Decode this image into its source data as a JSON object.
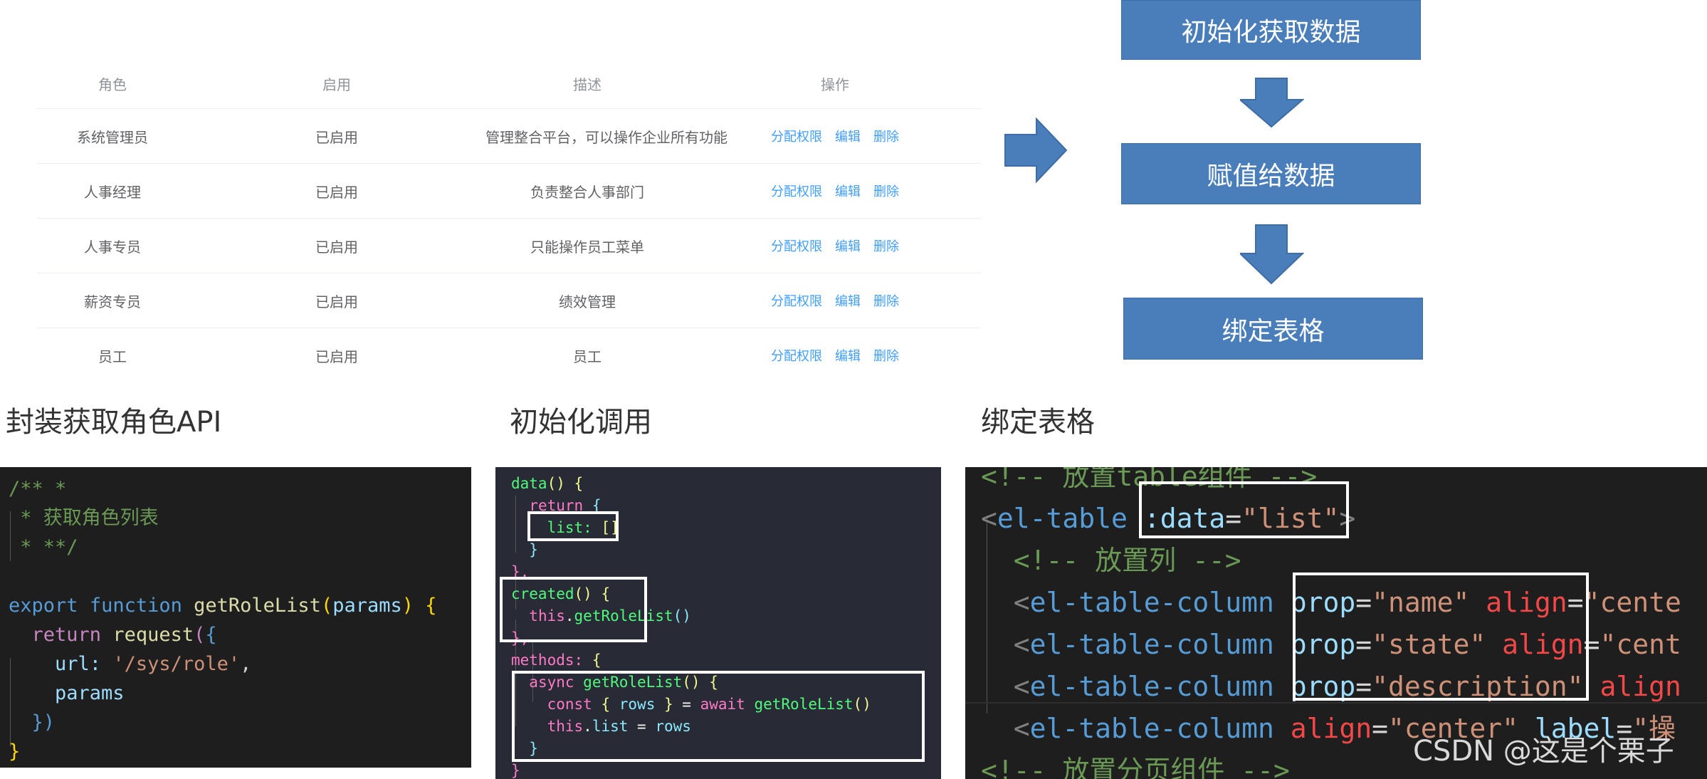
{
  "table": {
    "headers": [
      "角色",
      "启用",
      "描述",
      "操作"
    ],
    "rows": [
      {
        "name": "系统管理员",
        "state": "已启用",
        "description": "管理整合平台，可以操作企业所有功能"
      },
      {
        "name": "人事经理",
        "state": "已启用",
        "description": "负责整合人事部门"
      },
      {
        "name": "人事专员",
        "state": "已启用",
        "description": "只能操作员工菜单"
      },
      {
        "name": "薪资专员",
        "state": "已启用",
        "description": "绩效管理"
      },
      {
        "name": "员工",
        "state": "已启用",
        "description": "员工"
      }
    ],
    "actions": {
      "assign": "分配权限",
      "edit": "编辑",
      "delete": "删除"
    }
  },
  "flow": {
    "steps": [
      "初始化获取数据",
      "赋值给数据",
      "绑定表格"
    ],
    "color": "#4a7ebb"
  },
  "sections": {
    "api_title": "封装获取角色API",
    "init_title": "初始化调用",
    "bind_title": "绑定表格"
  },
  "code_api": {
    "l1": "/** *",
    "l2": " * 获取角色列表",
    "l3": " * **/",
    "l5_export": "export",
    "l5_function": "function",
    "l5_name": "getRoleList",
    "l5_param": "params",
    "l6_return": "return",
    "l6_call": "request",
    "l7_key": "url:",
    "l7_val": "'/sys/role'",
    "l8": "params",
    "l9": "})",
    "l10": "}"
  },
  "code_init": {
    "l1": "data",
    "l2": "return",
    "l3_key": "list:",
    "l3_val": "[]",
    "l6": "created",
    "l7_this": "this",
    "l7_call": "getRoleList",
    "l9": "methods:",
    "l10_async": "async",
    "l10_name": "getRoleList",
    "l11_const": "const",
    "l11_rows": "rows",
    "l11_await": "await",
    "l11_call": "getRoleList",
    "l12_this": "this",
    "l12_list": "list",
    "l12_rows": "rows"
  },
  "code_bind": {
    "c1": "<!-- 放置table组件 -->",
    "tag_table": "el-table",
    "attr_data": ":data",
    "val_list": "\"list\"",
    "c2": "<!-- 放置列 -->",
    "tag_col": "el-table-column",
    "attr_prop": "prop",
    "attr_align": "align",
    "val_name": "\"name\"",
    "val_center": "\"cente",
    "val_state": "\"state\"",
    "val_center2": "\"cent",
    "val_desc": "\"description\"",
    "attr_align_trunc": "align",
    "val_center_full": "\"center\"",
    "attr_label": "label",
    "val_label_trunc": "\"操",
    "c3": "<!-- 放置分页组件 -->"
  },
  "watermark": "CSDN @这是个栗子"
}
